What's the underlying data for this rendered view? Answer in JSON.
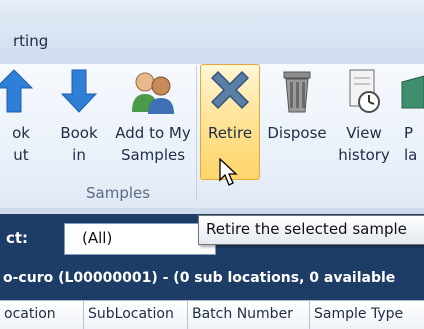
{
  "ribbon": {
    "tab_label": "rting",
    "group_label": "Samples",
    "buttons": [
      {
        "name": "book-out",
        "line1": "ok",
        "line2": "ut"
      },
      {
        "name": "book-in",
        "line1": "Book",
        "line2": "in"
      },
      {
        "name": "add-to-my-samples",
        "line1": "Add to My",
        "line2": "Samples"
      },
      {
        "name": "retire",
        "line1": "Retire",
        "line2": ""
      },
      {
        "name": "dispose",
        "line1": "Dispose",
        "line2": ""
      },
      {
        "name": "view-history",
        "line1": "View",
        "line2": "history"
      },
      {
        "name": "print-labels",
        "line1": "P",
        "line2": "la"
      }
    ]
  },
  "tooltip": {
    "text": "Retire the selected sample"
  },
  "select_bar": {
    "label": "ct:",
    "value": "(All)"
  },
  "info_bar": {
    "text": "o-curo  (L00000001)  -  (0 sub locations, 0 available"
  },
  "grid": {
    "columns": [
      "ocation",
      "SubLocation",
      "Batch Number",
      "Sample Type"
    ]
  },
  "colors": {
    "accent_blue": "#2f7fd6",
    "header_navy": "#1e3d66",
    "highlight": "#ffd56b"
  }
}
